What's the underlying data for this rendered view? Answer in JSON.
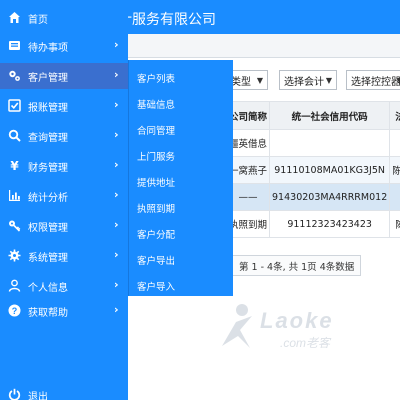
{
  "header": {
    "company_partial": "计服务有限公司"
  },
  "filters": {
    "type_partial": "类型",
    "accountant": "选择会计",
    "controller": "选择控控器"
  },
  "table": {
    "columns": [
      "公司简称",
      "统一社会信用代码",
      "法人"
    ],
    "rows": [
      [
        "僵英借息",
        "",
        ""
      ],
      [
        "一窝燕子",
        "91110108MA01KG3J5N",
        "陈利1"
      ],
      [
        "——",
        "91430203MA4RRRM012",
        ""
      ],
      [
        "执照到期",
        "91112323423423",
        "陈利"
      ]
    ]
  },
  "pager": {
    "summary": "第 1 - 4条, 共 1页 4条数据"
  },
  "watermark": {
    "main": "Laoke",
    "sub": ".com老客"
  },
  "sidebar": {
    "items": [
      {
        "label": "首页",
        "icon": "home-icon",
        "has_children": false
      },
      {
        "label": "待办事项",
        "icon": "todo-icon",
        "has_children": true
      },
      {
        "label": "客户管理",
        "icon": "gears-icon",
        "has_children": true,
        "active": true
      },
      {
        "label": "报账管理",
        "icon": "checkbox-icon",
        "has_children": true
      },
      {
        "label": "查询管理",
        "icon": "search-icon",
        "has_children": true
      },
      {
        "label": "财务管理",
        "icon": "yen-icon",
        "has_children": true
      },
      {
        "label": "统计分析",
        "icon": "bar-chart-icon",
        "has_children": true
      },
      {
        "label": "权限管理",
        "icon": "key-icon",
        "has_children": true
      },
      {
        "label": "系统管理",
        "icon": "gear-icon",
        "has_children": true
      },
      {
        "label": "个人信息",
        "icon": "user-icon",
        "has_children": true
      },
      {
        "label": "获取帮助",
        "icon": "help-icon",
        "has_children": true
      }
    ],
    "logout": {
      "label": "退出",
      "icon": "power-icon"
    }
  },
  "submenu": {
    "items": [
      "客户列表",
      "基础信息",
      "合同管理",
      "上门服务",
      "提供地址",
      "执照到期",
      "客户分配",
      "客户导出",
      "客户导入"
    ]
  },
  "colors": {
    "primary": "#1a8cff",
    "active": "#3a6fcf"
  }
}
